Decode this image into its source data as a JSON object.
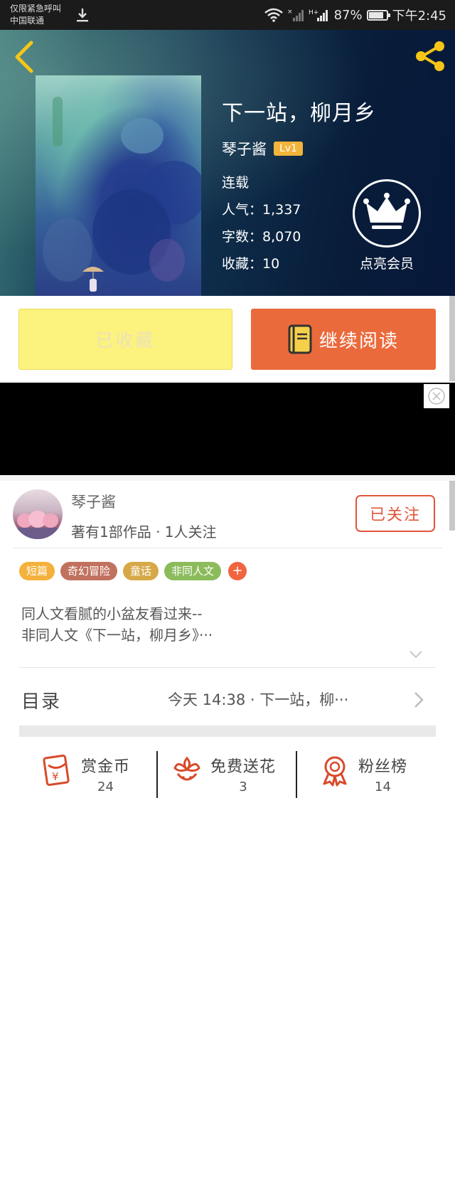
{
  "status_bar": {
    "carrier_line1": "仅限紧急呼叫",
    "carrier_line2": "中国联通",
    "network": "H+",
    "battery": "87%",
    "battery_level": 0.87,
    "time": "下午2:45"
  },
  "book": {
    "title": "下一站，柳月乡",
    "author": "琴子酱",
    "author_level": "Lv1",
    "status": "连载",
    "popularity": "人气：1,337",
    "word_count": "字数：8,070",
    "favorites": "收藏：10"
  },
  "vip": {
    "label": "点亮会员"
  },
  "actions": {
    "collected_label": "已收藏",
    "continue_label": "继续阅读"
  },
  "author_card": {
    "name": "琴子酱",
    "stats": "著有1部作品 · 1人关注",
    "follow_label": "已关注"
  },
  "tags": [
    {
      "label": "短篇",
      "color": "#f4b13b"
    },
    {
      "label": "奇幻冒险",
      "color": "#c0725f"
    },
    {
      "label": "童话",
      "color": "#d6a848"
    },
    {
      "label": "非同人文",
      "color": "#8cbb5c"
    }
  ],
  "tag_more": "+",
  "description": {
    "line1": "同人文看腻的小盆友看过来--",
    "line2": "非同人文《下一站，柳月乡》···"
  },
  "toc": {
    "label": "目录",
    "latest": "今天 14:38 · 下一站，柳···"
  },
  "bottom_bar": {
    "reward": {
      "label": "赏金币",
      "count": "24"
    },
    "flower": {
      "label": "免费送花",
      "count": "3"
    },
    "fans": {
      "label": "粉丝榜",
      "count": "14"
    }
  },
  "colors": {
    "accent_orange": "#eb6a3c",
    "follow_red": "#e0553a",
    "collected_yellow": "#fcf27e",
    "badge_gold": "#f2b43a"
  }
}
